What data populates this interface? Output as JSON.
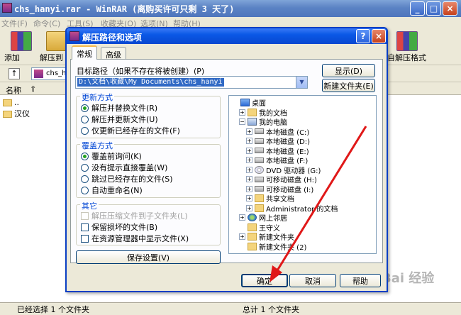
{
  "bg_window": {
    "title": "chs_hanyi.rar - WinRAR (离购买许可只剩 3 天了)",
    "menu": [
      "文件(F)",
      "命令(C)",
      "工具(S)",
      "收藏夹(O)",
      "选项(N)",
      "帮助(H)"
    ],
    "toolbar": {
      "add": "添加",
      "extract_to": "解压到",
      "self_extract": "自解压格式"
    },
    "address_value": "chs_ha",
    "list_header_name": "名称",
    "list_rows": [
      "..",
      "汉仪"
    ],
    "status_left": "已经选择 1 个文件夹",
    "status_right": "总计 1 个文件夹"
  },
  "watermark": "Bai 经验",
  "dialog": {
    "title": "解压路径和选项",
    "help": "?",
    "close": "×",
    "tabs": [
      "常规",
      "高级"
    ],
    "target_label": "目标路径（如果不存在将被创建）(P)",
    "target_path": "D:\\文档\\收藏\\My Documents\\chs_hanyi",
    "show_button": "显示(D)",
    "new_folder_button": "新建文件夹(E)",
    "update_group": {
      "title": "更新方式",
      "options": [
        "解压并替换文件(R)",
        "解压并更新文件(U)",
        "仅更新已经存在的文件(F)"
      ],
      "selected": 0
    },
    "overwrite_group": {
      "title": "覆盖方式",
      "options": [
        "覆盖前询问(K)",
        "没有提示直接覆盖(W)",
        "跳过已经存在的文件(S)",
        "自动重命名(N)"
      ],
      "selected": 0
    },
    "misc_group": {
      "title": "其它",
      "options": [
        "解压压缩文件到子文件夹(L)",
        "保留损坏的文件(B)",
        "在资源管理器中显示文件(X)"
      ],
      "disabled_index": 0
    },
    "save_settings_button": "保存设置(V)",
    "tree": [
      {
        "label": "桌面",
        "icon": "desktop-icon"
      },
      {
        "label": "我的文档",
        "icon": "documents-icon",
        "exp": "+"
      },
      {
        "label": "我的电脑",
        "icon": "computer-icon",
        "exp": "−"
      },
      {
        "label": "本地磁盘 (C:)",
        "icon": "drive-icon",
        "exp": "+"
      },
      {
        "label": "本地磁盘 (D:)",
        "icon": "drive-icon",
        "exp": "+"
      },
      {
        "label": "本地磁盘 (E:)",
        "icon": "drive-icon",
        "exp": "+"
      },
      {
        "label": "本地磁盘 (F:)",
        "icon": "drive-icon",
        "exp": "+"
      },
      {
        "label": "DVD 驱动器 (G:)",
        "icon": "cd-drive-icon",
        "exp": "+"
      },
      {
        "label": "可移动磁盘 (H:)",
        "icon": "drive-icon",
        "exp": "+"
      },
      {
        "label": "可移动磁盘 (I:)",
        "icon": "drive-icon",
        "exp": "+"
      },
      {
        "label": "共享文档",
        "icon": "folder-icon",
        "exp": "+"
      },
      {
        "label": "Administrator 的文档",
        "icon": "folder-icon",
        "exp": "+"
      },
      {
        "label": "网上邻居",
        "icon": "network-icon",
        "exp": "+"
      },
      {
        "label": "王守义",
        "icon": "folder-icon"
      },
      {
        "label": "新建文件夹",
        "icon": "folder-icon",
        "exp": "+"
      },
      {
        "label": "新建文件夹 (2)",
        "icon": "folder-icon"
      }
    ],
    "ok_button": "确定",
    "cancel_button": "取消",
    "help_button": "帮助"
  },
  "colors": {
    "accent": "#0a58e6",
    "arrow": "#e01818"
  }
}
